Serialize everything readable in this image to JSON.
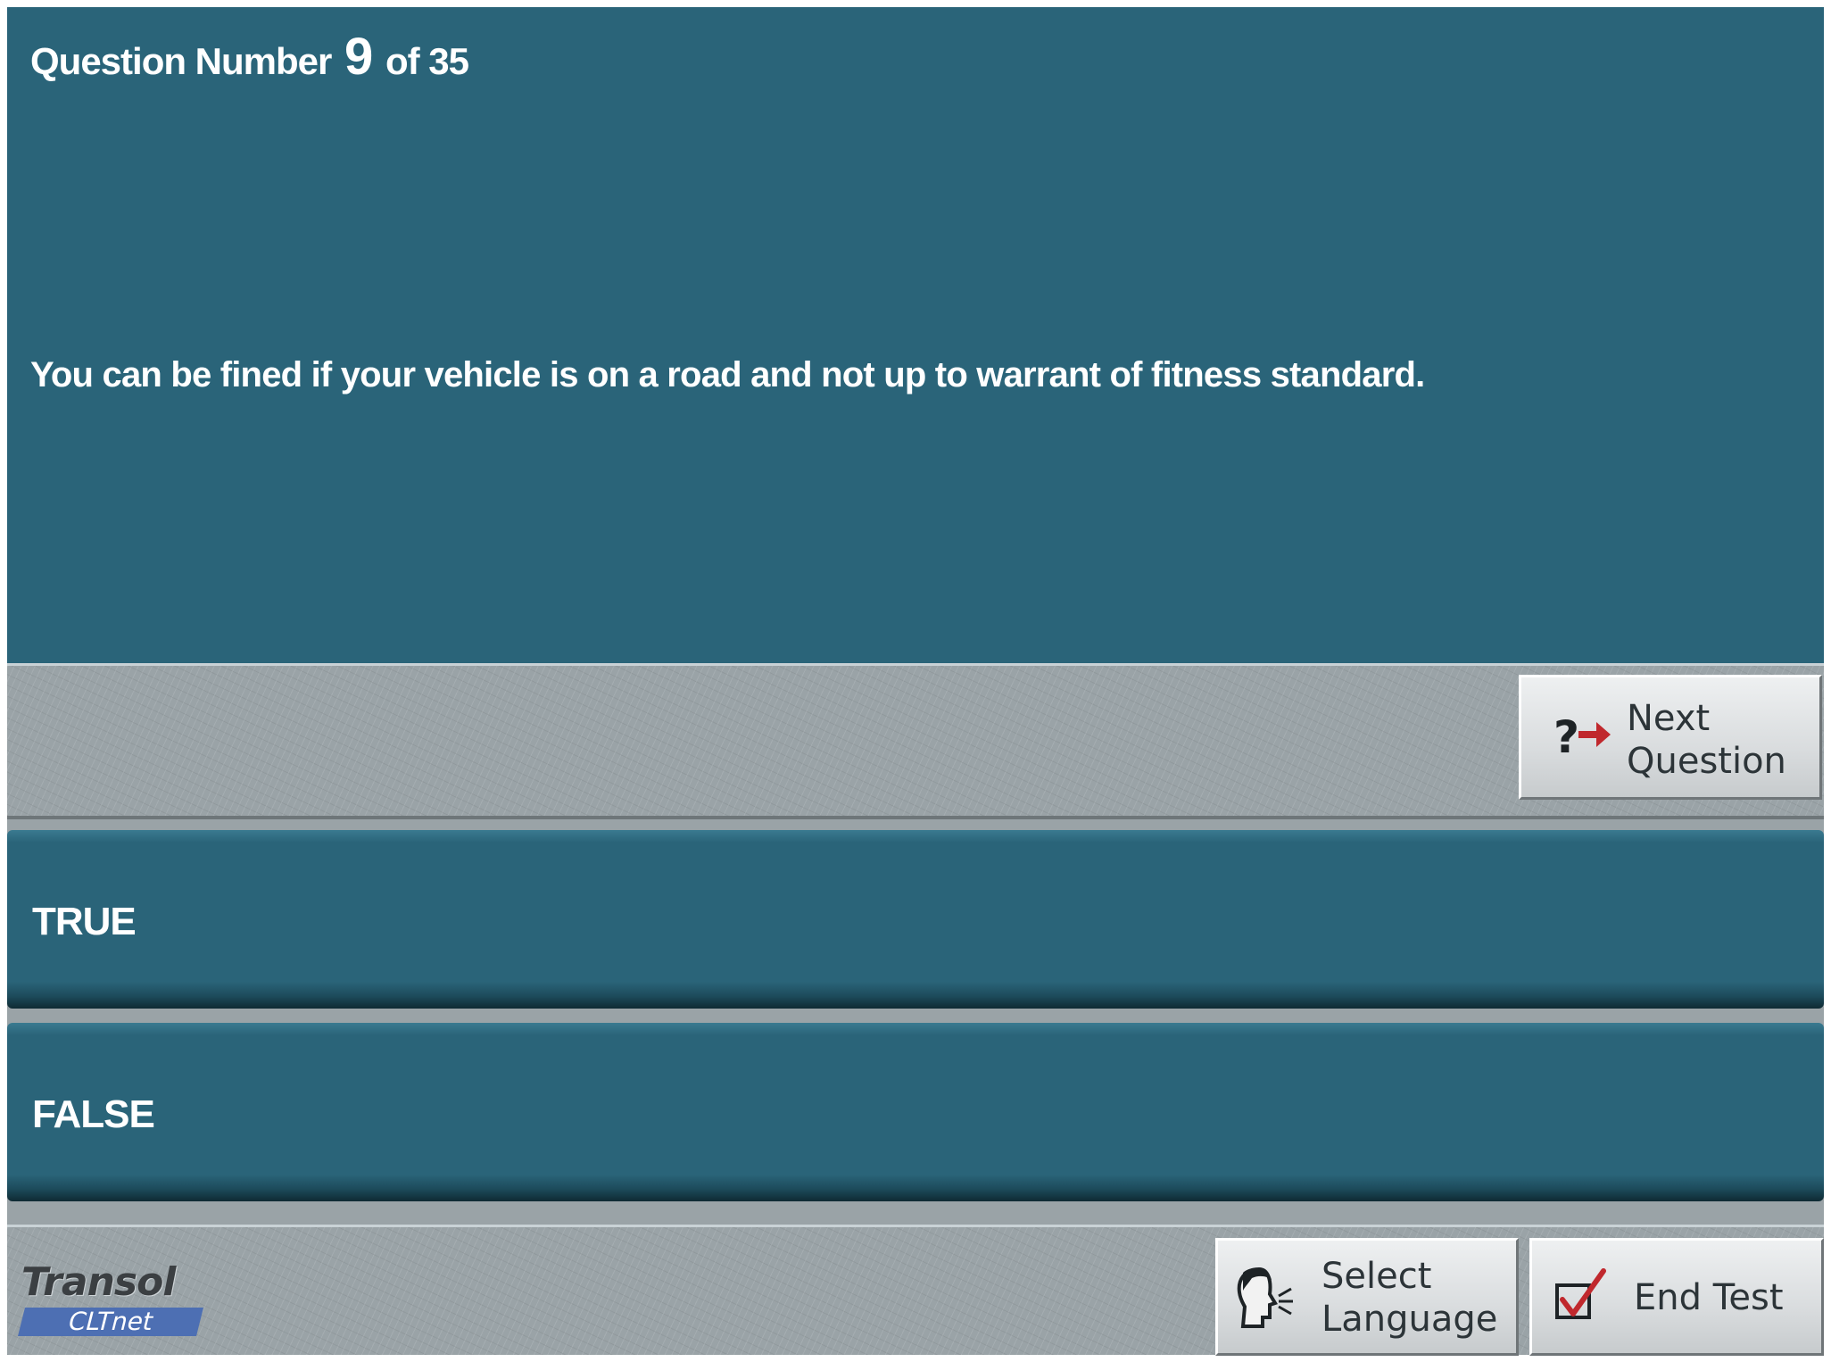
{
  "question": {
    "prefix": "Question Number",
    "number": "9",
    "suffix": "of 35",
    "text": "You can be fined if your vehicle is on a road and not up to warrant of fitness standard."
  },
  "buttons": {
    "next_line1": "Next",
    "next_line2": "Question",
    "select_language_line1": "Select",
    "select_language_line2": "Language",
    "end_test": "End Test"
  },
  "answers": [
    {
      "label": "TRUE"
    },
    {
      "label": "FALSE"
    }
  ],
  "logo": {
    "brand": "Transol",
    "product": "CLTnet"
  },
  "colors": {
    "panel": "#2a6479",
    "stone": "#9aa3a7",
    "arrow": "#c0282d",
    "check": "#c0282d"
  },
  "icons": {
    "next": "question-arrow-icon",
    "language": "speaking-head-icon",
    "end": "checkbox-check-icon"
  }
}
